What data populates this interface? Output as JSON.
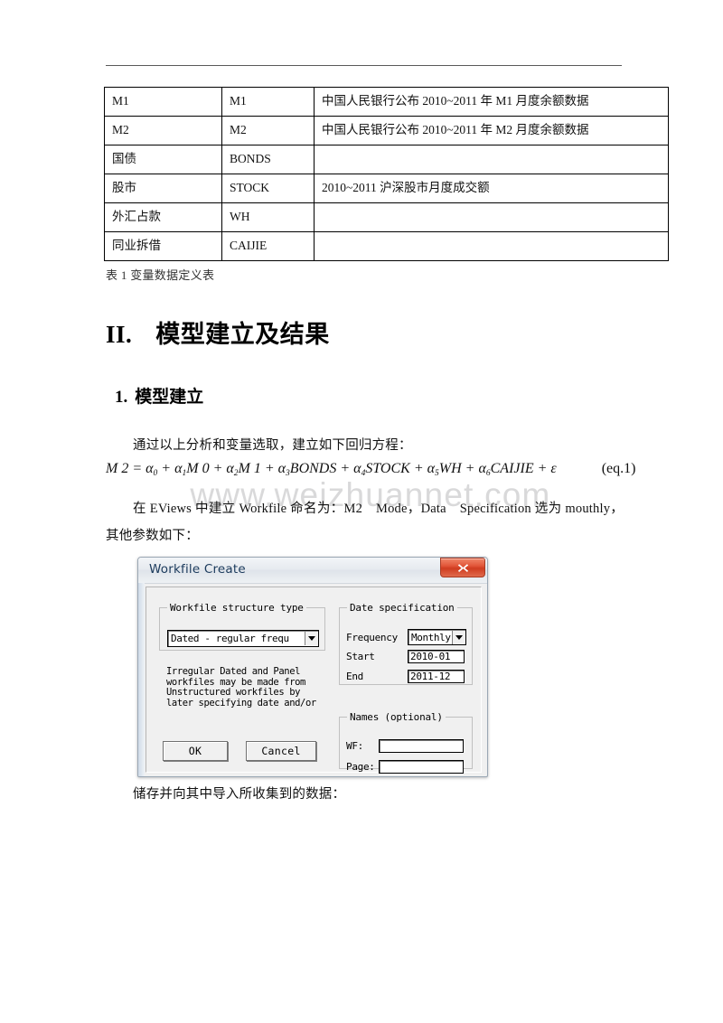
{
  "document": {
    "table": {
      "caption": "表 1 变量数据定义表",
      "rows": [
        {
          "c1": "M1",
          "c2": "M1",
          "c3": "中国人民银行公布 2010~2011 年 M1 月度余额数据"
        },
        {
          "c1": "M2",
          "c2": "M2",
          "c3": "中国人民银行公布 2010~2011 年 M2 月度余额数据"
        },
        {
          "c1": "国债",
          "c2": "BONDS",
          "c3": ""
        },
        {
          "c1": "股市",
          "c2": "STOCK",
          "c3": "2010~2011 沪深股市月度成交额"
        },
        {
          "c1": "外汇占款",
          "c2": "WH",
          "c3": ""
        },
        {
          "c1": "同业拆借",
          "c2": "CAIJIE",
          "c3": ""
        }
      ]
    },
    "heading1": {
      "number": "II.",
      "text": "模型建立及结果"
    },
    "heading2": {
      "number": "1.",
      "text": "模型建立"
    },
    "paragraphs": {
      "intro": "通过以上分析和变量选取，建立如下回归方程：",
      "eviews": "在 EViews 中建立 Workfile 命名为：M2　Mode，Data　Specification 选为 mouthly，其他参数如下：",
      "store": "储存并向其中导入所收集到的数据："
    },
    "equation": {
      "lhs": "M 2 =",
      "terms": [
        {
          "coef": "α",
          "sub": "0",
          "var": ""
        },
        {
          "coef": "α",
          "sub": "1",
          "var": "M 0"
        },
        {
          "coef": "α",
          "sub": "2",
          "var": "M 1"
        },
        {
          "coef": "α",
          "sub": "3",
          "var": "BONDS"
        },
        {
          "coef": "α",
          "sub": "4",
          "var": "STOCK"
        },
        {
          "coef": "α",
          "sub": "5",
          "var": "WH"
        },
        {
          "coef": "α",
          "sub": "6",
          "var": "CAIJIE"
        }
      ],
      "error": "ε",
      "tag": "(eq.1)",
      "plain": "M 2 = α0 + α1M 0 + α2M 1 + α3BONDS + α4STOCK + α5WH + α6CAIJIE + ε"
    },
    "watermark": "www.weizhuannet.com"
  },
  "dialog": {
    "title": "Workfile Create",
    "close_label": "×",
    "structure_group": {
      "legend": "Workfile structure type",
      "selected": "Dated - regular frequ"
    },
    "date_group": {
      "legend": "Date specification",
      "frequency_label": "Frequency",
      "frequency_value": "Monthly",
      "start_label": "Start",
      "start_value": "2010-01",
      "end_label": "End",
      "end_value": "2011-12"
    },
    "names_group": {
      "legend": "Names (optional)",
      "wf_label": "WF:",
      "wf_value": "",
      "page_label": "Page:",
      "page_value": ""
    },
    "help_text": "Irregular Dated and Panel workfiles may be made from Unstructured workfiles by later specifying date and/or other identifier series",
    "buttons": {
      "ok": "OK",
      "cancel": "Cancel"
    }
  },
  "colors": {
    "close_button": "#cf3c20",
    "title_text": "#1b3a5c",
    "dialog_face": "#f0f0f0",
    "watermark": "#d9d9da"
  }
}
